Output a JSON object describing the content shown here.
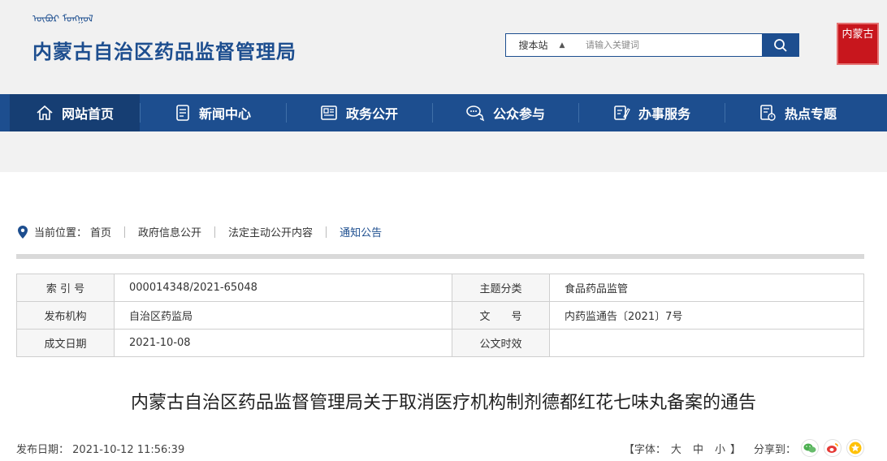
{
  "header": {
    "mongolian_text": "ᠥᠪᠦᠷ ᠮᠣᠩᠭᠣᠯ",
    "site_title": "内蒙古自治区药品监督管理局",
    "seal_text": "内蒙古"
  },
  "search": {
    "scope_label": "搜本站",
    "placeholder": "请输入关键词"
  },
  "nav": {
    "items": [
      {
        "label": "网站首页",
        "icon": "home-icon"
      },
      {
        "label": "新闻中心",
        "icon": "document-icon"
      },
      {
        "label": "政务公开",
        "icon": "newspaper-icon"
      },
      {
        "label": "公众参与",
        "icon": "chat-icon"
      },
      {
        "label": "办事服务",
        "icon": "edit-icon"
      },
      {
        "label": "热点专题",
        "icon": "report-icon"
      }
    ]
  },
  "breadcrumb": {
    "prefix": "当前位置：",
    "items": [
      "首页",
      "政府信息公开",
      "法定主动公开内容",
      "通知公告"
    ]
  },
  "meta": {
    "rows": [
      {
        "label1": "索 引 号",
        "value1": "000014348/2021-65048",
        "label2": "主题分类",
        "value2": "食品药品监管"
      },
      {
        "label1": "发布机构",
        "value1": "自治区药监局",
        "label2": "文　　号",
        "value2": "内药监通告〔2021〕7号"
      },
      {
        "label1": "成文日期",
        "value1": "2021-10-08",
        "label2": "公文时效",
        "value2": ""
      }
    ]
  },
  "article": {
    "title": "内蒙古自治区药品监督管理局关于取消医疗机构制剂德都红花七味丸备案的通告",
    "publish_label": "发布日期：",
    "publish_date": "2021-10-12 11:56:39",
    "font_size_prefix": "【字体：",
    "font_large": "大",
    "font_medium": "中",
    "font_small": "小",
    "font_size_suffix": "】",
    "share_label": "分享到："
  },
  "colors": {
    "brand_blue": "#1d4e8f",
    "nav_active": "#163e73",
    "seal_red": "#c8161d"
  }
}
